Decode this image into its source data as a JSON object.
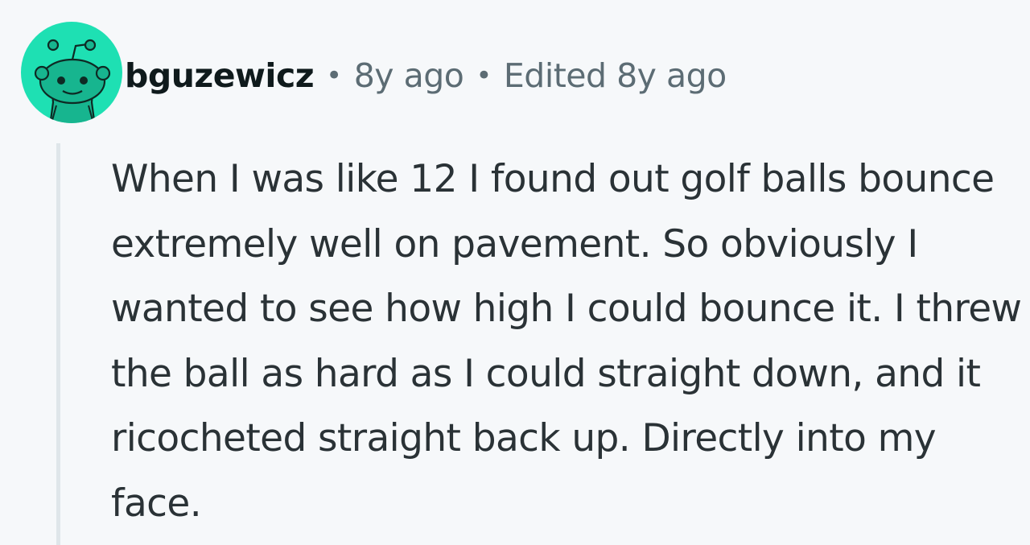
{
  "comment": {
    "author": "bguzewicz",
    "separator": "•",
    "posted": "8y ago",
    "edited": "Edited 8y ago",
    "avatar_icon": "snoo-avatar-icon",
    "avatar_color": "#1ee0b3",
    "body": "When I was like 12 I found out golf balls bounce extremely well on pavement. So obviously I wanted to see how high I could bounce it. I threw the ball as hard as I could straight down, and it ricocheted straight back up. Directly into my face."
  }
}
